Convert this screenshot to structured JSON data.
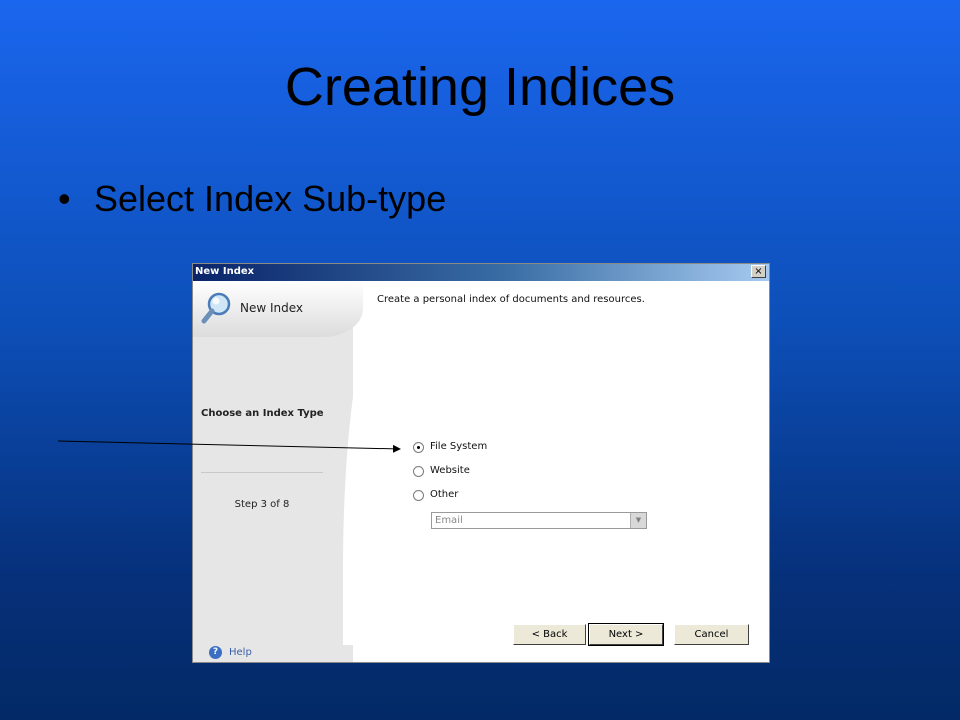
{
  "slide": {
    "title": "Creating Indices",
    "bullet": "Select Index Sub-type"
  },
  "dialog": {
    "title": "New Index",
    "close_glyph": "×",
    "header_label": "New Index",
    "header_icon": "magnifier-icon",
    "step_title": "Choose an Index Type",
    "step_counter": "Step 3 of 8",
    "help_label": "Help",
    "description": "Create a personal index of documents and resources.",
    "options": [
      {
        "label": "File System",
        "checked": true
      },
      {
        "label": "Website",
        "checked": false
      },
      {
        "label": "Other",
        "checked": false
      }
    ],
    "other_select": {
      "value": "Email",
      "disabled": true
    },
    "buttons": {
      "back": "< Back",
      "next": "Next >",
      "cancel": "Cancel"
    }
  },
  "colors": {
    "slide_background_top": "#1a66ee",
    "slide_background_bottom": "#032a66",
    "titlebar": "#0a246a",
    "help_link": "#3a5fa8"
  }
}
